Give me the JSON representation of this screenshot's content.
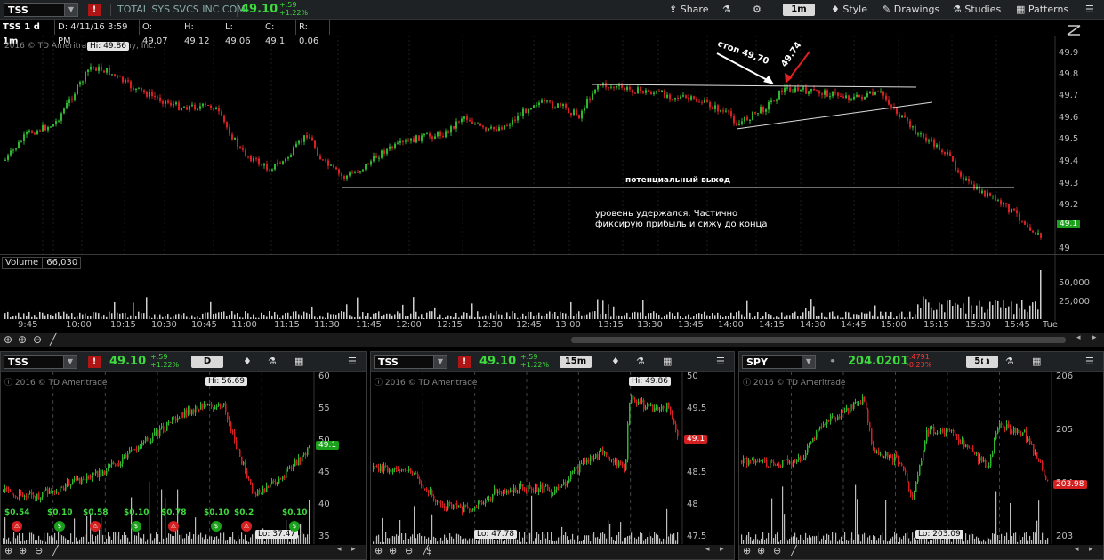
{
  "top": {
    "symbol": "TSS",
    "company": "TOTAL SYS SVCS INC COM",
    "last": "49.10",
    "change": "+.59",
    "change_pct": "+1.22%",
    "share": "Share",
    "period": "1m",
    "style": "Style",
    "drawings": "Drawings",
    "studies": "Studies",
    "patterns": "Patterns"
  },
  "info": {
    "title": "TSS 1 d 1m",
    "date": "D: 4/11/16 3:59 PM",
    "open": "O: 49.07",
    "high": "H: 49.12",
    "low": "L: 49.06",
    "close": "C: 49.1",
    "range": "R: 0.06"
  },
  "main": {
    "copyright": "2016 © TD Ameritrade",
    "copyright_tail": "ny, Inc.",
    "hi": "Hi: 49.86",
    "last_tag": "49.1",
    "annot_stop": "стоп 49,70",
    "annot_price": "49.74",
    "annot_exit": "потенциальный выход",
    "annot_note1": "уровень удержался. Частично",
    "annot_note2": "фиксирую прибыль и сижу до конца",
    "y_ticks": [
      "49.9",
      "49.8",
      "49.7",
      "49.6",
      "49.5",
      "49.4",
      "49.3",
      "49.2",
      "49"
    ],
    "volume_label": "Volume",
    "volume_value": "66,030",
    "vol_ticks": [
      "50,000",
      "25,000"
    ],
    "x_ticks": [
      "9:45",
      "10:00",
      "10:15",
      "10:30",
      "10:45",
      "11:00",
      "11:15",
      "11:30",
      "11:45",
      "12:00",
      "12:15",
      "12:30",
      "12:45",
      "13:00",
      "13:15",
      "13:30",
      "13:45",
      "14:00",
      "14:15",
      "14:30",
      "14:45",
      "15:00",
      "15:15",
      "15:30",
      "15:45",
      "Tue"
    ]
  },
  "panels": [
    {
      "symbol": "TSS",
      "last": "49.10",
      "chg": "+.59",
      "chg_pct": "+1.22%",
      "period": "D",
      "copyright": "2016 © TD Ameritrade",
      "hi": "Hi: 56.69",
      "lo": "Lo: 37.47",
      "tag": "49.1",
      "tag_color": "#1aa01a",
      "y_ticks": [
        "60",
        "55",
        "50",
        "45",
        "40",
        "35"
      ],
      "dividends": [
        "$0.54",
        "$0.10",
        "$0.58",
        "$0.10",
        "$0.78",
        "$0.10",
        "$0.2",
        "$0.10"
      ]
    },
    {
      "symbol": "TSS",
      "last": "49.10",
      "chg": "+.59",
      "chg_pct": "+1.22%",
      "period": "15m",
      "copyright": "2016 © TD Ameritrade",
      "hi": "Hi: 49.86",
      "lo": "Lo: 47.78",
      "tag": "49.1",
      "tag_color": "#d42020",
      "y_ticks": [
        "50",
        "49.5",
        "49",
        "48.5",
        "48",
        "47.5"
      ],
      "footer_sym": "$"
    },
    {
      "symbol": "SPY",
      "last": "204.0201",
      "chg": "-.4791",
      "chg_pct": "-0.23%",
      "period": "5m",
      "copyright": "2016 © TD Ameritrade",
      "hi": "",
      "lo": "Lo: 203.09",
      "tag": "203.98",
      "tag_color": "#d42020",
      "y_ticks": [
        "206",
        "205",
        "204",
        "203"
      ]
    }
  ],
  "colors": {
    "up": "#2fb52f",
    "down": "#d42020",
    "bg": "#000000",
    "header": "#1f2224"
  }
}
